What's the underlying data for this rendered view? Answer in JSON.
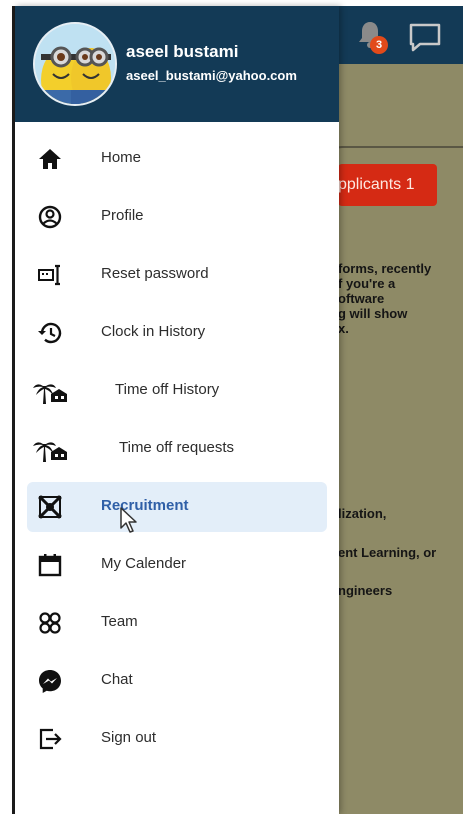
{
  "user": {
    "name": "aseel bustami",
    "email": "aseel_bustami@yahoo.com"
  },
  "topbar": {
    "notification_count": "3"
  },
  "background": {
    "applicants_button": "pplicants 1",
    "text_block_1": "forms, recently\nf you're a\noftware\ng will show\nx.",
    "text_block_2": "lization,",
    "text_block_3": "ent Learning, or",
    "text_block_4": "ngineers"
  },
  "menu": {
    "items": [
      {
        "label": "Home",
        "icon": "home-icon"
      },
      {
        "label": "Profile",
        "icon": "profile-icon"
      },
      {
        "label": "Reset password",
        "icon": "reset-password-icon"
      },
      {
        "label": "Clock in History",
        "icon": "history-icon"
      },
      {
        "label": "Time off History",
        "icon": "beach-icon"
      },
      {
        "label": "Time off requests",
        "icon": "beach-icon"
      },
      {
        "label": "Recruitment",
        "icon": "recruitment-icon",
        "active": true
      },
      {
        "label": "My Calender",
        "icon": "calendar-icon"
      },
      {
        "label": "Team",
        "icon": "team-icon"
      },
      {
        "label": "Chat",
        "icon": "messenger-icon"
      },
      {
        "label": "Sign out",
        "icon": "sign-out-icon"
      }
    ]
  },
  "colors": {
    "header": "#133a56",
    "active_bg": "#e3eef9",
    "active_text": "#2f5fa7",
    "applicants_button": "#d52a14"
  }
}
